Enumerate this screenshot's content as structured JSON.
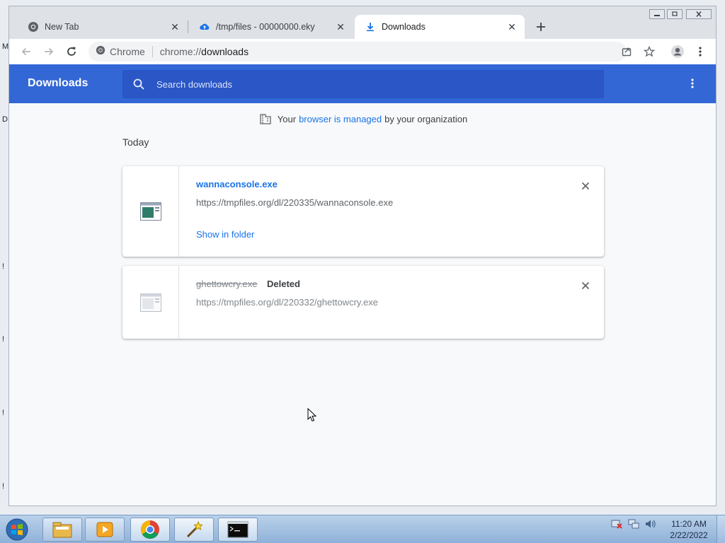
{
  "desktop": {
    "edge_chars": [
      "M",
      "D",
      "!",
      "!",
      "!",
      "!"
    ]
  },
  "browser": {
    "tabs": [
      {
        "title": "New Tab",
        "icon": "chrome-icon",
        "active": false
      },
      {
        "title": "/tmp/files - 00000000.eky",
        "icon": "cloud-upload-icon",
        "active": false
      },
      {
        "title": "Downloads",
        "icon": "download-icon",
        "active": true
      }
    ],
    "omnibox": {
      "site_label": "Chrome",
      "scheme": "chrome://",
      "path": "downloads"
    }
  },
  "downloads": {
    "title": "Downloads",
    "search_placeholder": "Search downloads",
    "managed": {
      "prefix": "Your",
      "link": "browser is managed",
      "suffix": "by your organization"
    },
    "section": "Today",
    "items": [
      {
        "filename": "wannaconsole.exe",
        "url": "https://tmpfiles.org/dl/220335/wannaconsole.exe",
        "action": "Show in folder",
        "status": ""
      },
      {
        "filename": "ghettowcry.exe",
        "url": "https://tmpfiles.org/dl/220332/ghettowcry.exe",
        "action": "",
        "status": "Deleted"
      }
    ]
  },
  "taskbar": {
    "apps": [
      "file-explorer-icon",
      "media-player-icon",
      "chrome-icon",
      "magic-wand-icon",
      "cmd-icon"
    ],
    "tray_icons": [
      "network-error-icon",
      "network-icon",
      "volume-icon"
    ],
    "time": "11:20 AM",
    "date": "2/22/2022"
  }
}
